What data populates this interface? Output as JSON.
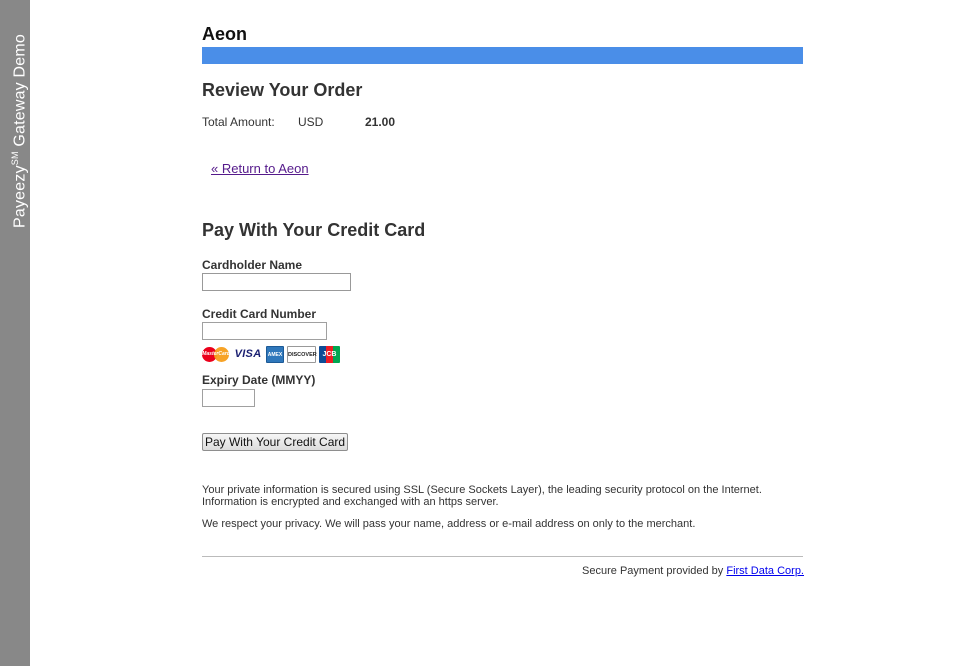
{
  "side_banner": {
    "brand": "Payeezy",
    "mark": "SM",
    "suffix": "Gateway Demo"
  },
  "merchant": {
    "name": "Aeon"
  },
  "colors": {
    "accent_bar": "#4a8ee8",
    "side_banner": "#888888",
    "visited_link": "#551a8b",
    "link": "#0000ee"
  },
  "review": {
    "title": "Review Your Order",
    "total_label": "Total Amount:",
    "currency": "USD",
    "amount": "21.00"
  },
  "return_link": "« Return to Aeon",
  "payment": {
    "title": "Pay With Your Credit Card",
    "cardholder_label": "Cardholder Name",
    "cardholder_value": "",
    "card_number_label": "Credit Card Number",
    "card_number_value": "",
    "expiry_label": "Expiry Date (MMYY)",
    "expiry_value": "",
    "submit_label": "Pay With Your Credit Card",
    "card_logos": {
      "mastercard": "MasterCard",
      "visa": "VISA",
      "amex": "AMEX",
      "discover": "DISCOVER",
      "jcb": "JCB"
    }
  },
  "notices": {
    "security": "Your private information is secured using SSL (Secure Sockets Layer), the leading security protocol on the Internet. Information is encrypted and exchanged with an https server.",
    "privacy": "We respect your privacy. We will pass your name, address or e-mail address on only to the merchant."
  },
  "footer": {
    "text": "Secure Payment provided by ",
    "link_text": "First Data Corp."
  }
}
